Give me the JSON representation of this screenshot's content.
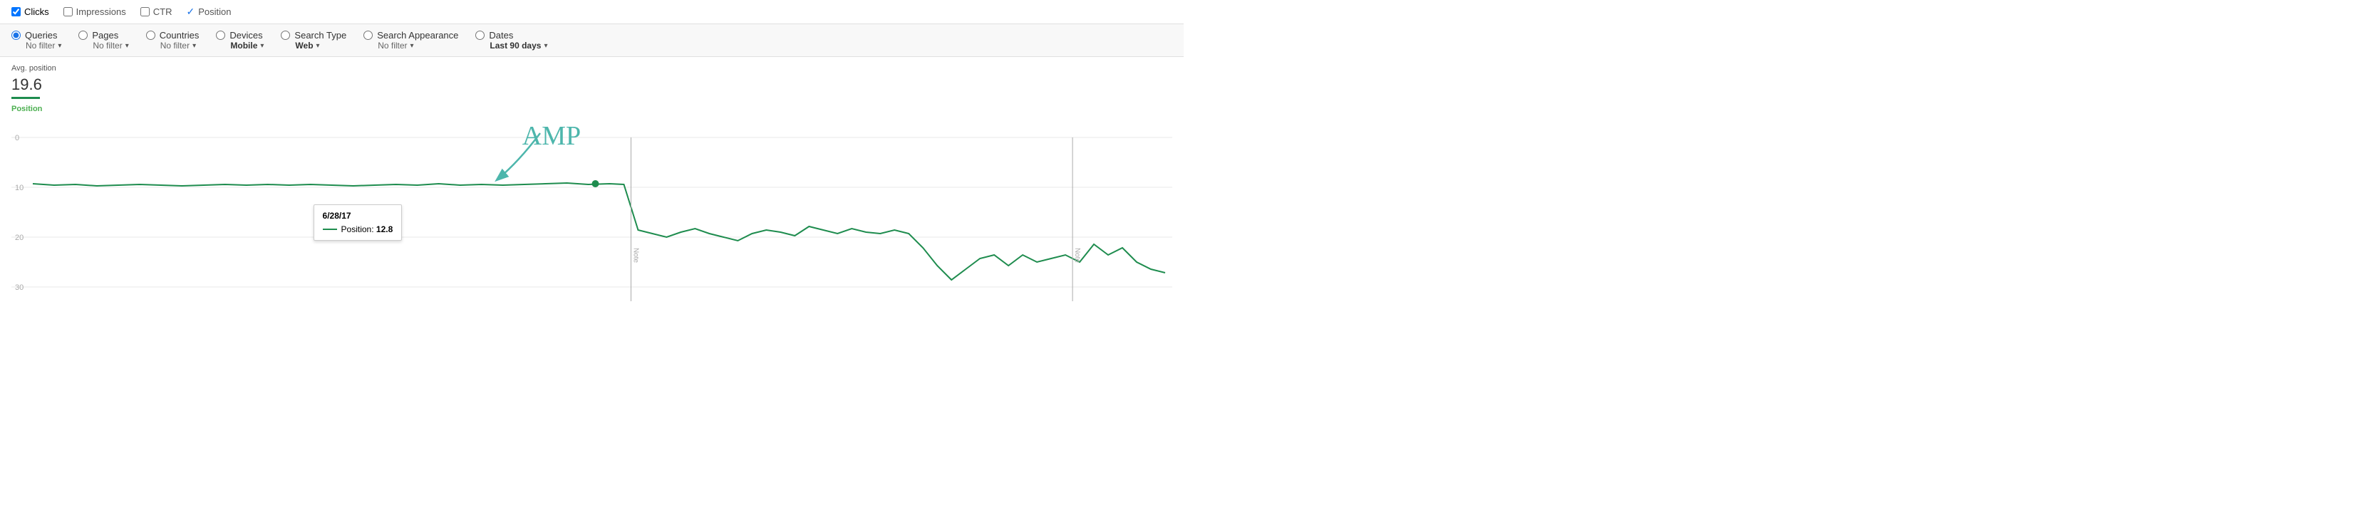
{
  "checkboxBar": {
    "clicks": {
      "label": "Clicks",
      "checked": true
    },
    "impressions": {
      "label": "Impressions",
      "checked": false
    },
    "ctr": {
      "label": "CTR",
      "checked": false
    },
    "position": {
      "label": "Position",
      "checked": true,
      "checkmark": true
    }
  },
  "filterBar": {
    "items": [
      {
        "id": "queries",
        "label": "Queries",
        "sublabel": "No filter",
        "selected": true,
        "hasDropdown": true
      },
      {
        "id": "pages",
        "label": "Pages",
        "sublabel": "No filter",
        "selected": false,
        "hasDropdown": true
      },
      {
        "id": "countries",
        "label": "Countries",
        "sublabel": "No filter",
        "selected": false,
        "hasDropdown": true
      },
      {
        "id": "devices",
        "label": "Devices",
        "sublabel": "Mobile",
        "sublabelBold": true,
        "selected": false,
        "hasDropdown": true
      },
      {
        "id": "search-type",
        "label": "Search Type",
        "sublabel": "Web",
        "sublabelBold": true,
        "selected": false,
        "hasDropdown": true
      },
      {
        "id": "search-appearance",
        "label": "Search Appearance",
        "sublabel": "No filter",
        "selected": false,
        "hasDropdown": true
      },
      {
        "id": "dates",
        "label": "Dates",
        "sublabel": "Last 90 days",
        "sublabelBold": true,
        "selected": false,
        "hasDropdown": true
      }
    ]
  },
  "avgPosition": {
    "title": "Avg. position",
    "value": "19.6"
  },
  "chart": {
    "yAxisLabel": "Position",
    "gridLines": [
      "0",
      "10",
      "20",
      "30"
    ],
    "tooltip": {
      "date": "6/28/17",
      "metricLabel": "Position:",
      "metricValue": "12.8"
    },
    "ampLabel": "AMP",
    "noteLabels": [
      "Note",
      "Note"
    ]
  }
}
